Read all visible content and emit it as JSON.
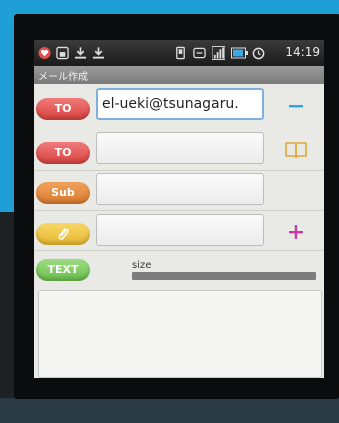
{
  "status_bar": {
    "time": "14:19",
    "icons": [
      "heart-notification-icon",
      "lock-app-icon",
      "download-icon",
      "download-icon",
      "vibrate-icon",
      "sync-icon",
      "signal-icon",
      "battery-icon",
      "alarm-icon"
    ]
  },
  "title": "メール作成",
  "fields": [
    {
      "label": "TO",
      "value": "el-ueki@tsunagaru.",
      "color": "#e04f4c"
    },
    {
      "label": "TO",
      "value": "",
      "color": "#e04f4c"
    },
    {
      "label": "Sub",
      "value": "",
      "color": "#e0843a"
    },
    {
      "label": "",
      "value": "",
      "color": "#f0c440"
    }
  ],
  "text_button": "TEXT",
  "size_label": "size",
  "size_fill": 1.0,
  "colors": {
    "accent_minus": "#2aa9e0",
    "accent_book": "#e3a836",
    "accent_plus": "#c23aa6"
  }
}
